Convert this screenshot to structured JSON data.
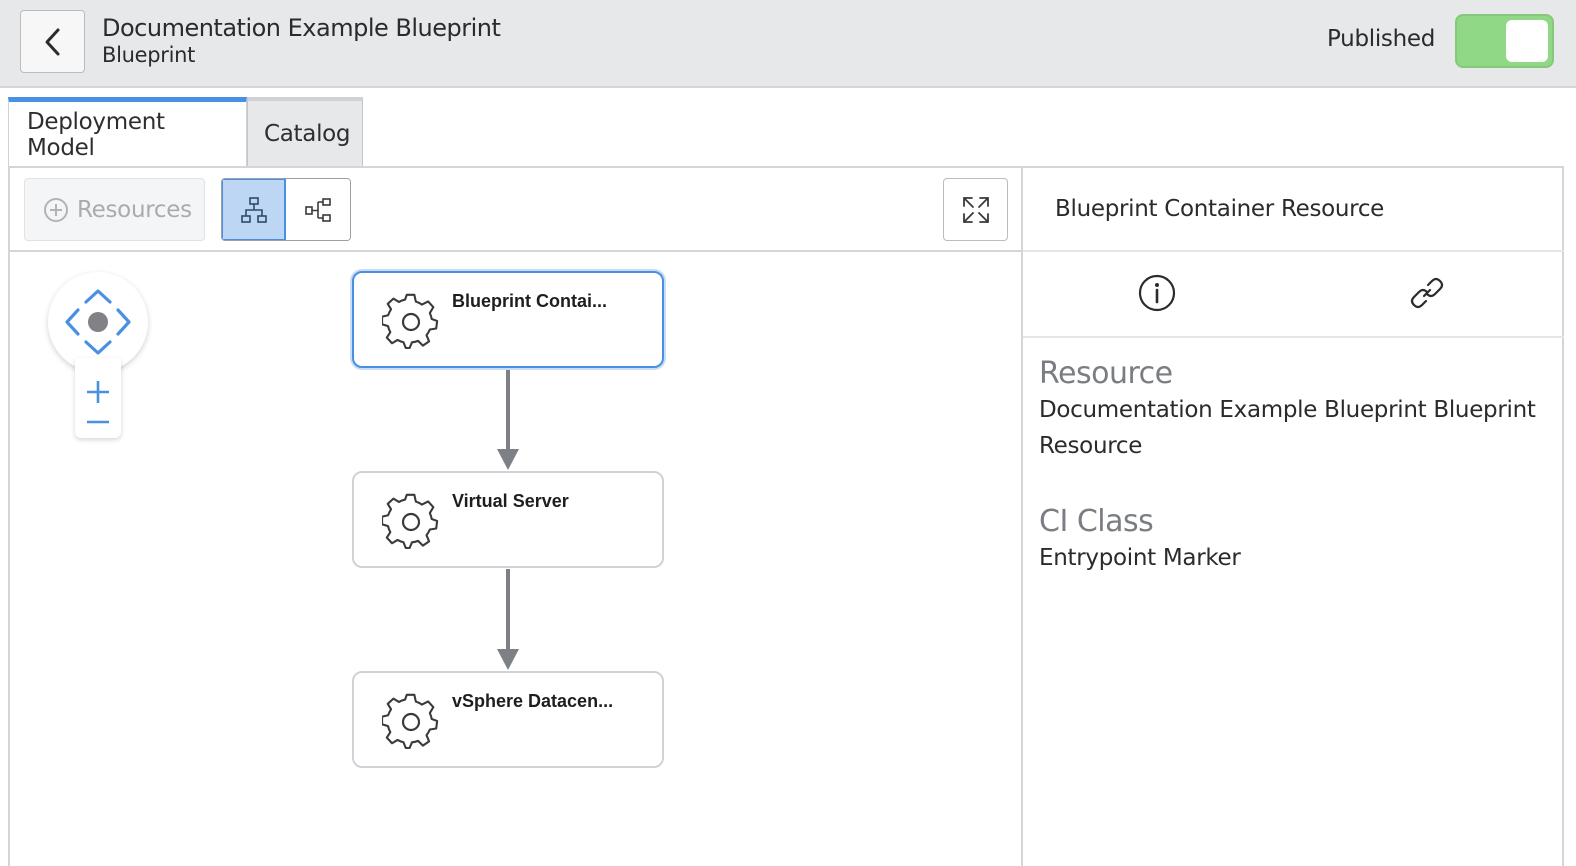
{
  "header": {
    "title": "Documentation Example Blueprint",
    "subtitle": "Blueprint",
    "published_label": "Published",
    "published": true
  },
  "tabs": [
    {
      "label": "Deployment Model",
      "active": true
    },
    {
      "label": "Catalog",
      "active": false
    }
  ],
  "toolbar": {
    "resources_label": "Resources"
  },
  "diagram": {
    "nodes": [
      {
        "label": "Blueprint Contai...",
        "selected": true
      },
      {
        "label": "Virtual Server",
        "selected": false
      },
      {
        "label": "vSphere Datacen...",
        "selected": false
      }
    ]
  },
  "side_panel": {
    "title": "Blueprint Container Resource",
    "fields": [
      {
        "label": "Resource",
        "value": "Documentation Example Blueprint Blueprint Resource"
      },
      {
        "label": "CI Class",
        "value": "Entrypoint Marker"
      }
    ]
  },
  "colors": {
    "accent": "#4a90e2",
    "toggle_on": "#90d886",
    "header_bg": "#e7e8ea"
  }
}
